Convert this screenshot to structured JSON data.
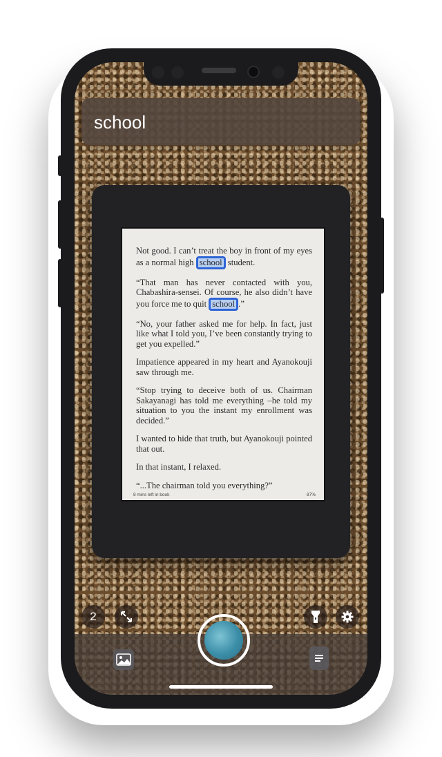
{
  "search": {
    "query": "school"
  },
  "book": {
    "paragraphs": [
      [
        {
          "text": "Not good. I can’t treat the boy in front of my eyes as a normal high "
        },
        {
          "text": "school",
          "highlight": true
        },
        {
          "text": " student."
        }
      ],
      [
        {
          "text": "“That man has never contacted with you, Chabashira-sensei. Of course, he also didn’t have you force me to quit "
        },
        {
          "text": "school",
          "highlight": true
        },
        {
          "text": ".”"
        }
      ],
      [
        {
          "text": "“No, your father asked me for help. In fact, just like what I told you, I’ve been constantly trying to get you expelled.”"
        }
      ],
      [
        {
          "text": "Impatience appeared in my heart and Ayanokouji saw through me."
        }
      ],
      [
        {
          "text": "“Stop trying to deceive both of us. Chairman Sakayanagi has told me everything –he told my situation to you the instant my enrollment was decided.”"
        }
      ],
      [
        {
          "text": "I wanted to hide that truth, but Ayanokouji pointed that out."
        }
      ],
      [
        {
          "text": "In that instant, I relaxed."
        }
      ],
      [
        {
          "text": "“...The chairman told you everything?”"
        }
      ]
    ],
    "footer_left": "8 mins left in book",
    "footer_right": "87%"
  },
  "controls": {
    "match_count": "2",
    "expand_icon": "expand-arrows-icon",
    "flashlight_icon": "flashlight-icon",
    "settings_icon": "gear-icon",
    "gallery_icon": "photo-gallery-icon",
    "text_icon": "document-text-icon"
  },
  "colors": {
    "highlight_border": "#2f65d6",
    "highlight_fill": "#78aaff"
  }
}
